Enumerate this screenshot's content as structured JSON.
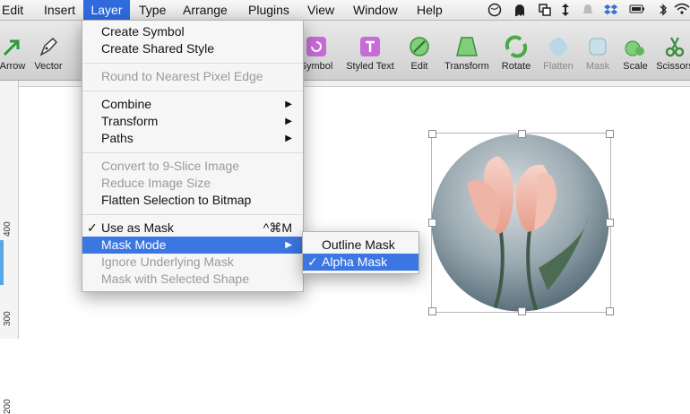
{
  "menubar": {
    "items": [
      "Edit",
      "Insert",
      "Layer",
      "Type",
      "Arrange",
      "Plugins",
      "View",
      "Window",
      "Help"
    ],
    "active": "Layer"
  },
  "toolbar": {
    "tools": [
      {
        "label": "Arrow",
        "icon": "arrow-tool-icon",
        "enabled": true
      },
      {
        "label": "Vector",
        "icon": "vector-pen-icon",
        "enabled": true
      },
      {
        "label": "Symbol",
        "icon": "symbol-icon",
        "enabled": true
      },
      {
        "label": "Styled Text",
        "icon": "styled-text-icon",
        "enabled": true
      },
      {
        "label": "Edit",
        "icon": "edit-icon",
        "enabled": true
      },
      {
        "label": "Transform",
        "icon": "transform-icon",
        "enabled": true
      },
      {
        "label": "Rotate",
        "icon": "rotate-icon",
        "enabled": true
      },
      {
        "label": "Flatten",
        "icon": "flatten-icon",
        "enabled": false
      },
      {
        "label": "Mask",
        "icon": "mask-icon",
        "enabled": false
      },
      {
        "label": "Scale",
        "icon": "scale-icon",
        "enabled": true
      },
      {
        "label": "Scissors",
        "icon": "scissors-icon",
        "enabled": true
      }
    ]
  },
  "ruler": {
    "labels": [
      "400",
      "300",
      "200"
    ]
  },
  "layer_menu": {
    "items": [
      {
        "label": "Create Symbol",
        "enabled": true
      },
      {
        "label": "Create Shared Style",
        "enabled": true
      },
      {
        "label": "Round to Nearest Pixel Edge",
        "enabled": false
      },
      {
        "label": "Combine",
        "enabled": true,
        "submenu": true
      },
      {
        "label": "Transform",
        "enabled": true,
        "submenu": true
      },
      {
        "label": "Paths",
        "enabled": true,
        "submenu": true
      },
      {
        "label": "Convert to 9-Slice Image",
        "enabled": false
      },
      {
        "label": "Reduce Image Size",
        "enabled": false
      },
      {
        "label": "Flatten Selection to Bitmap",
        "enabled": true
      },
      {
        "label": "Use as Mask",
        "enabled": true,
        "checked": true,
        "shortcut": "^⌘M"
      },
      {
        "label": "Mask Mode",
        "enabled": true,
        "submenu": true,
        "highlighted": true
      },
      {
        "label": "Ignore Underlying Mask",
        "enabled": false
      },
      {
        "label": "Mask with Selected Shape",
        "enabled": false
      }
    ]
  },
  "mask_mode_submenu": {
    "items": [
      {
        "label": "Outline Mask",
        "checked": false
      },
      {
        "label": "Alpha Mask",
        "checked": true,
        "highlighted": true
      }
    ]
  },
  "glyphs": {
    "check": "✓",
    "submenu_arrow": "▶"
  },
  "colors": {
    "menu_highlight": "#3b76e3",
    "menubar_active": "#2f6bdf"
  }
}
